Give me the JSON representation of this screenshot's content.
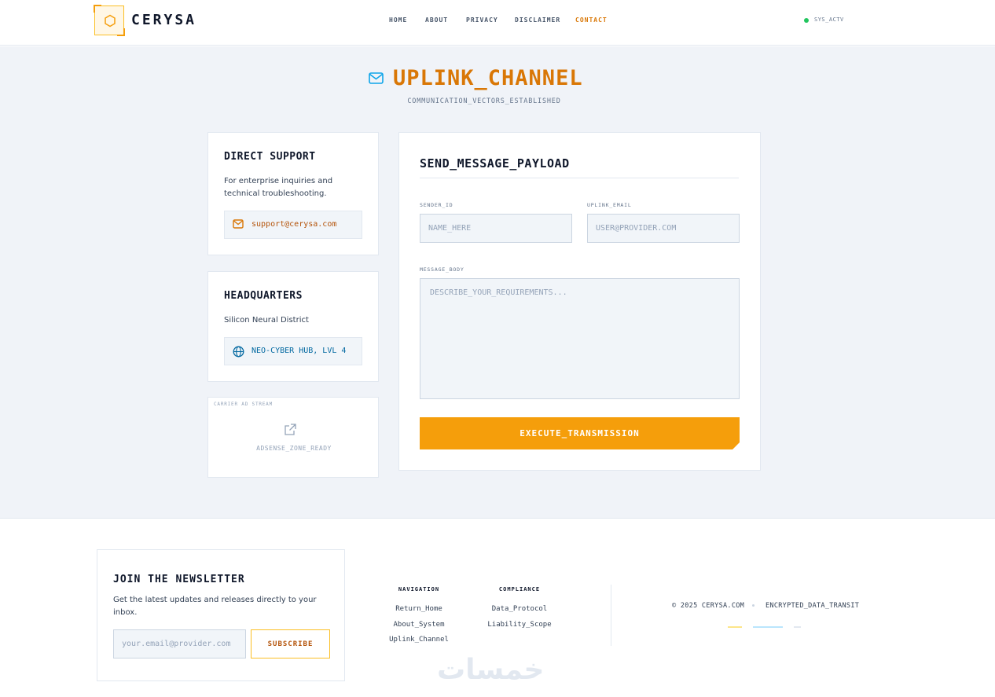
{
  "header": {
    "brand": "CERYSA",
    "nav": [
      "HOME",
      "ABOUT",
      "PRIVACY",
      "DISCLAIMER",
      "CONTACT"
    ],
    "active_nav": "CONTACT",
    "status": "SYS_ACTV"
  },
  "hero": {
    "title": "UPLINK_CHANNEL",
    "subtitle": "COMMUNICATION_VECTORS_ESTABLISHED"
  },
  "support": {
    "title": "DIRECT SUPPORT",
    "text": "For enterprise inquiries and technical troubleshooting.",
    "email": "support@cerysa.com"
  },
  "hq": {
    "title": "HEADQUARTERS",
    "text": "Silicon Neural District",
    "location": "NEO-CYBER HUB, LVL 4"
  },
  "ad": {
    "label": "CARRIER AD STREAM",
    "text": "ADSENSE_ZONE_READY"
  },
  "form": {
    "title": "SEND_MESSAGE_PAYLOAD",
    "sender_label": "SENDER_ID",
    "sender_placeholder": "NAME_HERE",
    "email_label": "UPLINK_EMAIL",
    "email_placeholder": "USER@PROVIDER.COM",
    "message_label": "MESSAGE_BODY",
    "message_placeholder": "DESCRIBE_YOUR_REQUIREMENTS...",
    "submit": "EXECUTE_TRANSMISSION"
  },
  "newsletter": {
    "title": "JOIN THE NEWSLETTER",
    "text": "Get the latest updates and releases directly to your inbox.",
    "placeholder": "your.email@provider.com",
    "button": "SUBSCRIBE"
  },
  "footer": {
    "navigation_head": "NAVIGATION",
    "navigation_links": [
      "Return_Home",
      "About_System",
      "Uplink_Channel"
    ],
    "compliance_head": "COMPLIANCE",
    "compliance_links": [
      "Data_Protocol",
      "Liability_Scope"
    ],
    "copyright": "© 2025 CERYSA.COM",
    "tagline": "ENCRYPTED_DATA_TRANSIT"
  },
  "watermark": "خمسات",
  "colors": {
    "accent": "#f59e0b",
    "accent_dark": "#d97706",
    "link_blue": "#0369a1",
    "status_green": "#22c55e",
    "background": "#f0f3f8"
  },
  "icons": {
    "logo": "hexagon-icon",
    "title": "envelope-icon",
    "support": "envelope-icon",
    "hq": "globe-icon",
    "ad": "external-link-icon"
  }
}
